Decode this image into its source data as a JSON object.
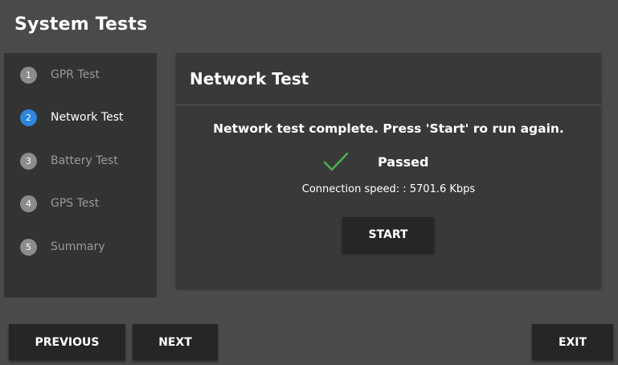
{
  "app": {
    "title": "System Tests"
  },
  "sidebar": {
    "steps": [
      {
        "number": "1",
        "label": "GPR Test",
        "active": false
      },
      {
        "number": "2",
        "label": "Network Test",
        "active": true
      },
      {
        "number": "3",
        "label": "Battery Test",
        "active": false
      },
      {
        "number": "4",
        "label": "GPS Test",
        "active": false
      },
      {
        "number": "5",
        "label": "Summary",
        "active": false
      }
    ]
  },
  "panel": {
    "title": "Network Test",
    "message": "Network test complete. Press 'Start' ro run again.",
    "result": {
      "icon": "checkmark-icon",
      "label": "Passed"
    },
    "speed": "Connection speed: : 5701.6 Kbps",
    "start_label": "START"
  },
  "footer": {
    "previous_label": "PREVIOUS",
    "next_label": "NEXT",
    "exit_label": "EXIT"
  },
  "colors": {
    "background": "#4a4a4a",
    "sidebar": "#333333",
    "panel": "#393939",
    "button": "#262626",
    "active_step": "#2e86de",
    "inactive_step": "#8c8c8c",
    "success": "#4caf50"
  }
}
